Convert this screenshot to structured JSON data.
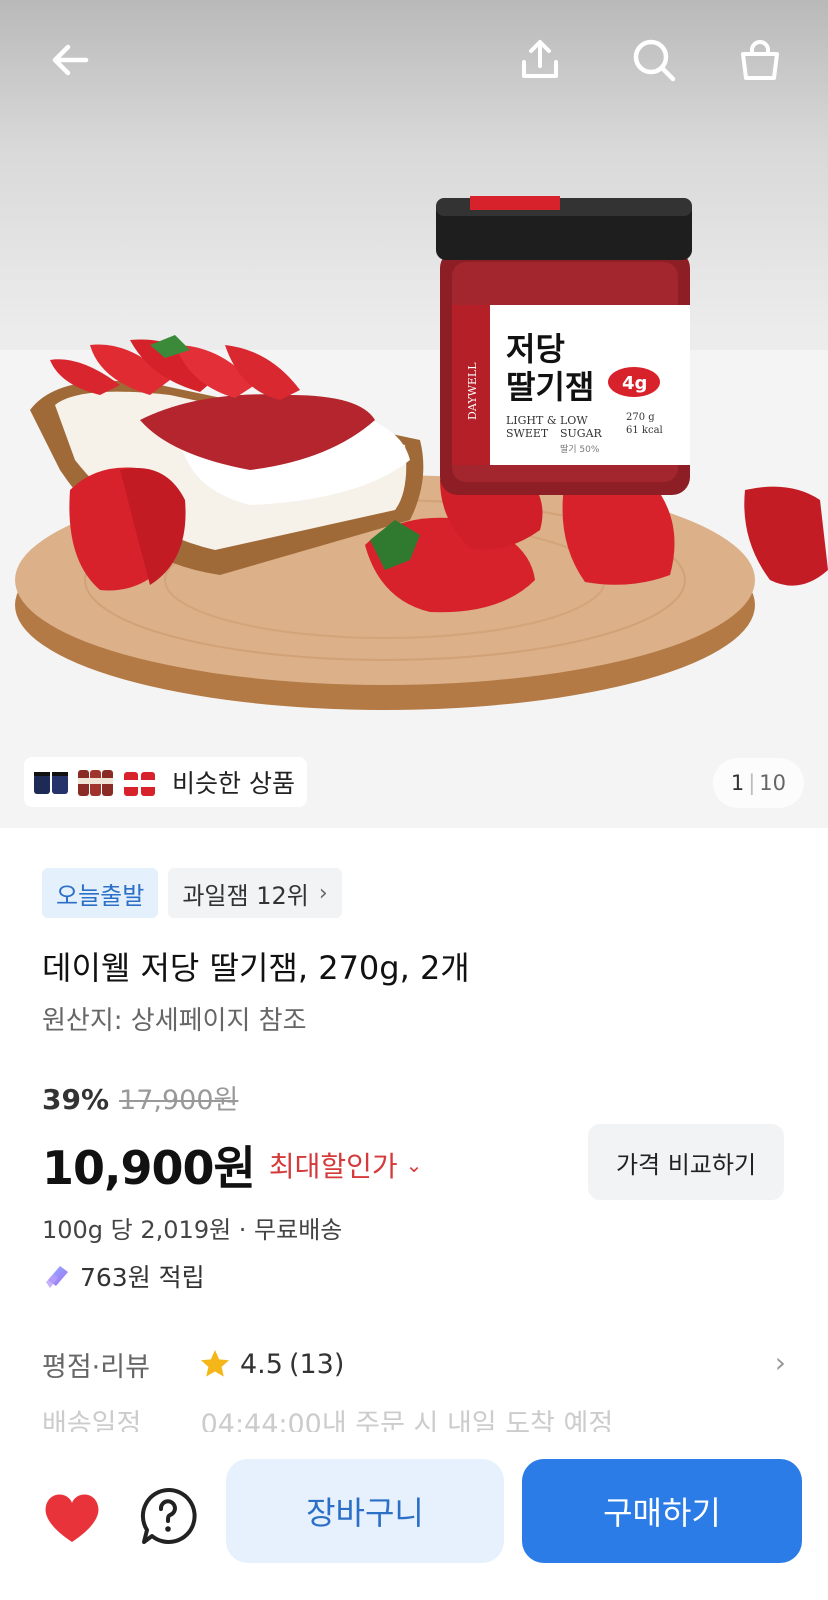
{
  "hero": {
    "page_current": "1",
    "page_total": "10",
    "similar_label": "비슷한 상품",
    "jar_label": {
      "brand": "DAYWELL",
      "name_line1": "저당",
      "name_line2": "딸기잼",
      "sugar_badge": "4g",
      "tag1": "LIGHT &",
      "tag2": "SWEET",
      "tag3": "LOW",
      "tag4": "SUGAR",
      "weight": "270 g",
      "kcal": "61 kcal",
      "fruit_pct": "딸기 50%"
    }
  },
  "badges": {
    "today_ship": "오늘출발",
    "ranking": "과일잼 12위"
  },
  "product": {
    "title": "데이웰 저당 딸기잼, 270g, 2개",
    "origin": "원산지: 상세페이지 참조",
    "discount_pct": "39%",
    "original_price": "17,900원",
    "price": "10,900원",
    "max_discount_label": "최대할인가",
    "compare_label": "가격 비교하기",
    "unit_price": "100g 당 2,019원 · 무료배송",
    "points": "763원 적립"
  },
  "rating": {
    "label": "평점·리뷰",
    "value": "4.5",
    "count": "(13)"
  },
  "shipping": {
    "label": "배송일정",
    "text": "04:44:00내 주문 시 내일 도착 예정"
  },
  "bottom": {
    "cart_label": "장바구니",
    "buy_label": "구매하기"
  },
  "colors": {
    "accent_blue": "#2b7ce6",
    "discount_red": "#d43a3a",
    "heart_red": "#e8333a"
  }
}
